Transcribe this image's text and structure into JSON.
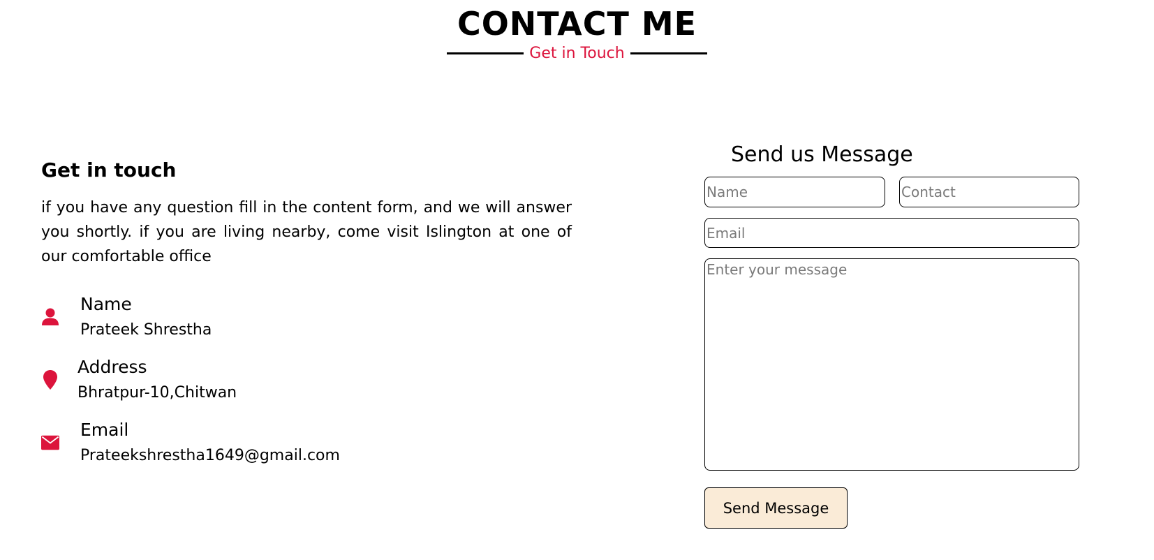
{
  "header": {
    "title": "CONTACT ME",
    "subtitle": "Get in Touch"
  },
  "info": {
    "title": "Get in touch",
    "description": "if you have any question fill in the content form, and we will answer you shortly. if you are living nearby, come visit Islington at one of our comfortable office",
    "items": [
      {
        "icon": "user-icon",
        "label": "Name",
        "value": "Prateek Shrestha"
      },
      {
        "icon": "map-pin-icon",
        "label": "Address",
        "value": "Bhratpur-10,Chitwan"
      },
      {
        "icon": "envelope-icon",
        "label": "Email",
        "value": "Prateekshrestha1649@gmail.com"
      }
    ]
  },
  "form": {
    "title": "Send us Message",
    "name_placeholder": "Name",
    "contact_placeholder": "Contact",
    "email_placeholder": "Email",
    "message_placeholder": "Enter your message",
    "submit_label": "Send Message"
  },
  "colors": {
    "accent": "#dc143c",
    "button_bg": "#faebd7"
  }
}
